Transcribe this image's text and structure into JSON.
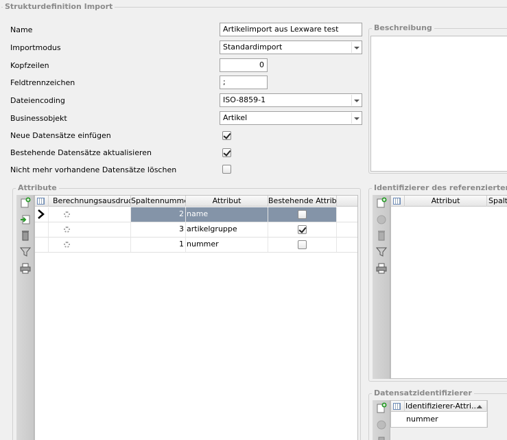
{
  "main_group": {
    "title": "Strukturdefinition Import"
  },
  "form": {
    "name_label": "Name",
    "name_value": "Artikelimport aus Lexware test",
    "importmodus_label": "Importmodus",
    "importmodus_value": "Standardimport",
    "kopfzeilen_label": "Kopfzeilen",
    "kopfzeilen_value": "0",
    "feldtrennzeichen_label": "Feldtrennzeichen",
    "feldtrennzeichen_value": ";",
    "dateiencoding_label": "Dateiencoding",
    "dateiencoding_value": "ISO-8859-1",
    "businessobjekt_label": "Businessobjekt",
    "businessobjekt_value": "Artikel",
    "neue_label": "Neue Datensätze einfügen",
    "neue_checked": true,
    "bestehende_label": "Bestehende Datensätze aktualisieren",
    "bestehende_checked": true,
    "loeschen_label": "Nicht mehr vorhandene Datensätze löschen",
    "loeschen_checked": false
  },
  "beschreibung": {
    "title": "Beschreibung",
    "value": ""
  },
  "attribute": {
    "title": "Attribute",
    "columns": [
      "Berechnungsausdruck",
      "Spaltennummer",
      "Attribut",
      "Bestehende Attrib..."
    ],
    "rows": [
      {
        "spaltennummer": "2",
        "attribut": "name",
        "bestehende": false,
        "selected": true
      },
      {
        "spaltennummer": "3",
        "attribut": "artikelgruppe",
        "bestehende": true,
        "selected": false
      },
      {
        "spaltennummer": "1",
        "attribut": "nummer",
        "bestehende": false,
        "selected": false
      }
    ]
  },
  "identifizierer": {
    "title": "Identifizierer des referenzierten Da",
    "columns": [
      "Attribut",
      "Spalte"
    ]
  },
  "datensatzidentifizierer": {
    "title": "Datensatzidentifizierer",
    "columns": [
      "Identifizierer-Attri..."
    ],
    "rows": [
      {
        "value": "nummer"
      }
    ]
  },
  "icons": {
    "toolbar": [
      "add-row-icon",
      "import-row-icon",
      "delete-icon",
      "filter-icon",
      "print-icon"
    ]
  },
  "colors": {
    "selected_row": "#8494a8",
    "legend_text": "#8a8a8a"
  }
}
